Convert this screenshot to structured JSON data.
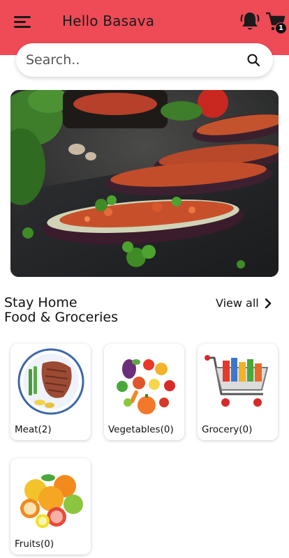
{
  "header": {
    "greeting": "Hello Basava",
    "cart_count": "1",
    "accent_color": "#ee4b57",
    "icons": [
      "menu-icon",
      "bell-icon",
      "cart-icon"
    ]
  },
  "search": {
    "placeholder": "Search.."
  },
  "section": {
    "title_line1": "Stay Home",
    "title_line2": "Food & Groceries",
    "view_all_label": "View all"
  },
  "categories": [
    {
      "label": "Meat(2)"
    },
    {
      "label": "Vegetables(0)"
    },
    {
      "label": "Grocery(0)"
    },
    {
      "label": "Fruits(0)"
    }
  ]
}
